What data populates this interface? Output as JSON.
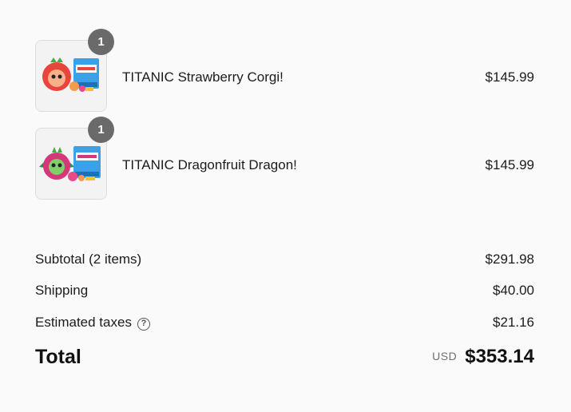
{
  "line_items": [
    {
      "name": "TITANIC Strawberry Corgi!",
      "price": "$145.99",
      "quantity": "1",
      "image_icon": "strawberry-corgi-plush-image",
      "accent_color": "#e8453c"
    },
    {
      "name": "TITANIC Dragonfruit Dragon!",
      "price": "$145.99",
      "quantity": "1",
      "image_icon": "dragonfruit-dragon-plush-image",
      "accent_color": "#d6367a"
    }
  ],
  "summary": {
    "subtotal_label": "Subtotal (2 items)",
    "subtotal_value": "$291.98",
    "shipping_label": "Shipping",
    "shipping_value": "$40.00",
    "taxes_label": "Estimated taxes",
    "taxes_help_icon": "question-circle-icon",
    "taxes_value": "$21.16",
    "total_label": "Total",
    "currency": "USD",
    "total_value": "$353.14"
  },
  "colors": {
    "background": "#fafafa",
    "badge": "#6a6a6a",
    "box_blue": "#3aa0e8"
  }
}
